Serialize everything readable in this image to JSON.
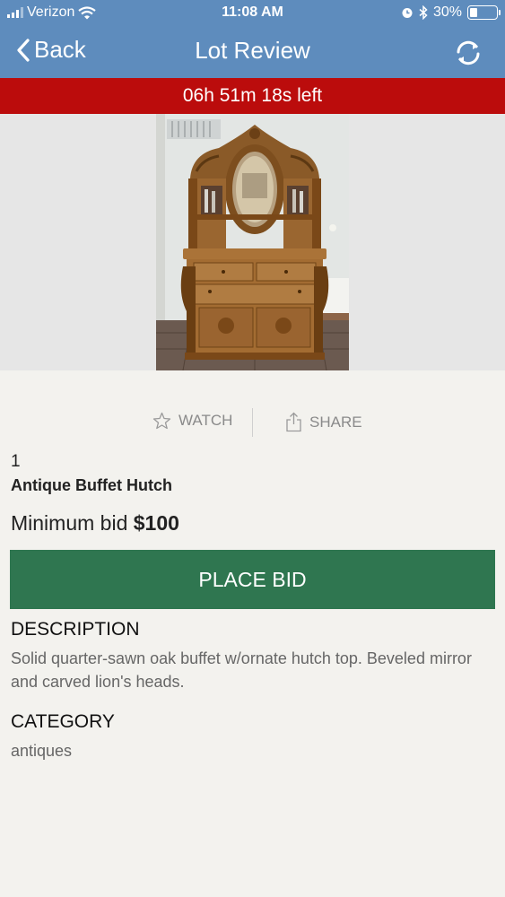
{
  "status_bar": {
    "carrier": "Verizon",
    "time": "11:08 AM",
    "battery_percent": "30%",
    "battery_level": 0.3,
    "icons": [
      "signal-icon",
      "wifi-icon",
      "alarm-icon",
      "bluetooth-icon",
      "battery-icon"
    ]
  },
  "nav": {
    "back_label": "Back",
    "title": "Lot Review",
    "refresh_icon": "refresh-icon"
  },
  "timer": {
    "text": "06h 51m 18s left",
    "color": "#bb0c0c"
  },
  "actions": {
    "watch_label": "WATCH",
    "share_label": "SHARE"
  },
  "lot": {
    "number": "1",
    "title": "Antique Buffet Hutch",
    "min_bid_label": "Minimum bid",
    "min_bid_value": "$100"
  },
  "bid_button": {
    "label": "PLACE BID",
    "color": "#2f7650"
  },
  "description": {
    "heading": "DESCRIPTION",
    "text": "Solid quarter-sawn oak buffet w/ornate hutch top. Beveled mirror and carved lion's heads."
  },
  "category": {
    "heading": "CATEGORY",
    "value": "antiques"
  },
  "colors": {
    "header": "#5e8cbd",
    "background": "#f3f2ee"
  }
}
